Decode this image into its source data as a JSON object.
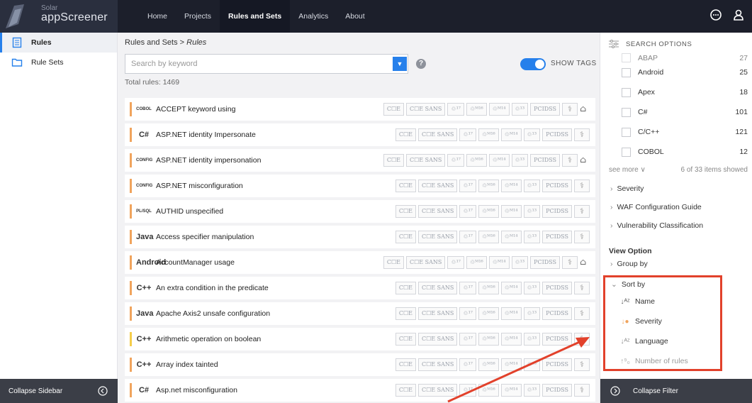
{
  "app": {
    "logo_small": "Solar",
    "logo_big": "appScreener"
  },
  "nav": [
    "Home",
    "Projects",
    "Rules and Sets",
    "Analytics",
    "About"
  ],
  "sidebar": {
    "items": [
      {
        "label": "Rules",
        "icon": "document-icon"
      },
      {
        "label": "Rule Sets",
        "icon": "folder-icon"
      }
    ],
    "collapse_label": "Collapse Sidebar"
  },
  "main": {
    "breadcrumb_root": "Rules and Sets",
    "breadcrumb_sep": " > ",
    "breadcrumb_current": "Rules",
    "search_placeholder": "Search by keyword",
    "show_tags_label": "SHOW TAGS",
    "total": "Total rules: 1469"
  },
  "tag_labels": {
    "cwe": "C☐E",
    "cwe_sans": "C☐E SANS",
    "owasp17": "♲¹⁷",
    "owaspm16": "♲ᴹ¹⁶",
    "owaspm14": "♲ᴹ¹⁴",
    "owasp13": "♲¹³",
    "pcidss": "PCIDSS",
    "hipaa": "⚕"
  },
  "rules": [
    {
      "name": "ACCEPT keyword using",
      "lang": "COBOL",
      "color": "#f0a45d",
      "user": true
    },
    {
      "name": "ASP.NET identity Impersonate",
      "lang": "C#",
      "color": "#f0a45d",
      "user": false
    },
    {
      "name": "ASP.NET identity impersonation",
      "lang": "CONFIG",
      "color": "#f0a45d",
      "user": true
    },
    {
      "name": "ASP.NET misconfiguration",
      "lang": "CONFIG",
      "color": "#f0a45d",
      "user": false
    },
    {
      "name": "AUTHID unspecified",
      "lang": "PL/SQL",
      "color": "#f0a45d",
      "user": false
    },
    {
      "name": "Access specifier manipulation",
      "lang": "Java",
      "color": "#f0a45d",
      "user": false
    },
    {
      "name": "AccountManager usage",
      "lang": "Android",
      "color": "#f0a45d",
      "user": true
    },
    {
      "name": "An extra condition in the predicate",
      "lang": "C++",
      "color": "#f0a45d",
      "user": false
    },
    {
      "name": "Apache Axis2 unsafe configuration",
      "lang": "Java",
      "color": "#f0a45d",
      "user": false
    },
    {
      "name": "Arithmetic operation on boolean",
      "lang": "C++",
      "color": "#f5cd4a",
      "user": false
    },
    {
      "name": "Array index tainted",
      "lang": "C++",
      "color": "#f0a45d",
      "user": false
    },
    {
      "name": "Asp.net misconfiguration",
      "lang": "C#",
      "color": "#f0a45d",
      "user": false
    }
  ],
  "filter": {
    "title": "SEARCH OPTIONS",
    "cut_item": {
      "name": "ABAP",
      "count": "27"
    },
    "languages": [
      {
        "name": "Android",
        "count": "25"
      },
      {
        "name": "Apex",
        "count": "18"
      },
      {
        "name": "C#",
        "count": "101"
      },
      {
        "name": "C/C++",
        "count": "121"
      },
      {
        "name": "COBOL",
        "count": "12"
      }
    ],
    "see_more": "see more ∨",
    "items_showed": "6 of 33 items showed",
    "sections": [
      "Severity",
      "WAF Configuration Guide",
      "Vulnerability Classification"
    ],
    "view_option": "View Option",
    "group_by": "Group by",
    "sort_by": "Sort by",
    "sort_options": [
      {
        "label": "Name",
        "icon": "sort-alpha-icon"
      },
      {
        "label": "Severity",
        "icon": "sort-severity-icon"
      },
      {
        "label": "Language",
        "icon": "sort-alpha-icon"
      },
      {
        "label": "Number of rules",
        "icon": "sort-numeric-icon"
      }
    ],
    "collapse_label": "Collapse Filter"
  },
  "colors": {
    "accent": "#2680eb",
    "topbar": "#1c1f2b",
    "highlight": "#e2412b",
    "severity_medium": "#f0a45d",
    "severity_low": "#f5cd4a"
  }
}
